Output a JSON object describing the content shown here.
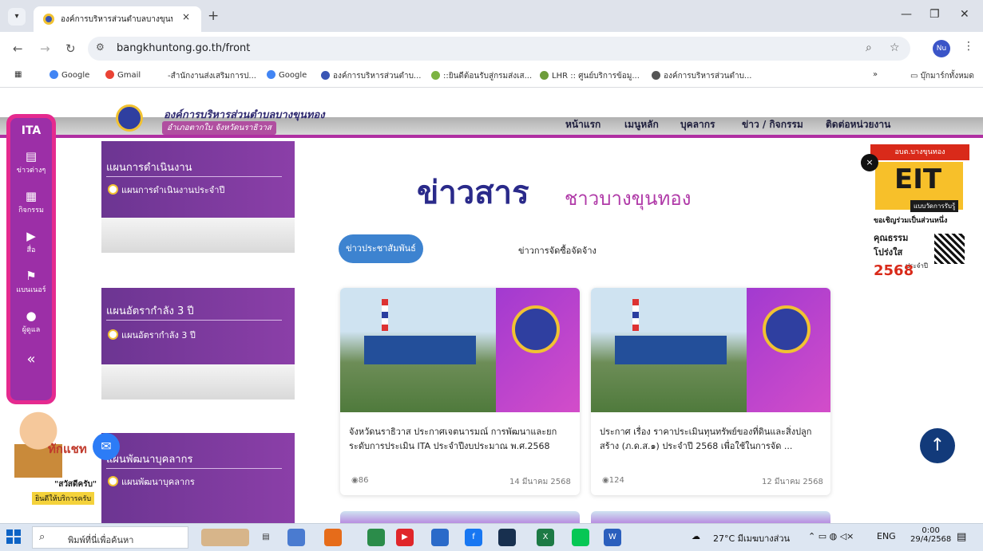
{
  "browser": {
    "tab_title": "องค์การบริหารส่วนตำบลบางขุนทอง",
    "tab_close": "×",
    "new_tab": "+",
    "url": "bangkhuntong.go.th/front",
    "profile": "Nu",
    "bookmarks": [
      {
        "label": "Google",
        "color": "#4285f4"
      },
      {
        "label": "Gmail",
        "color": "#ea4335"
      },
      {
        "label": "-สำนักงานส่งเสริมการป...",
        "color": "#ffffff"
      },
      {
        "label": "Google",
        "color": "#4285f4"
      },
      {
        "label": "องค์การบริหารส่วนตำบ...",
        "color": "#3a55b4"
      },
      {
        "label": "::ยินดีต้อนรับสู่กรมส่งเส...",
        "color": "#7cb342"
      },
      {
        "label": "LHR :: ศูนย์บริการข้อมู...",
        "color": "#6d9c3a"
      },
      {
        "label": "องค์การบริหารส่วนตำบ...",
        "color": "#555555"
      }
    ],
    "bookmarks_more": "»",
    "all_bookmarks": "บุ๊กมาร์กทั้งหมด"
  },
  "site": {
    "org_name": "องค์การบริหารส่วนตำบลบางขุนทอง",
    "org_sub": "อำเภอตากใบ จังหวัดนราธิวาส",
    "nav": [
      "หน้าแรก",
      "เมนูหลัก",
      "บุคลากร",
      "ข่าว / กิจกรรม",
      "ติดต่อหน่วยงาน"
    ]
  },
  "rail": {
    "logo": "ITA",
    "items": [
      {
        "label": "ข่าวต่างๆ",
        "icon": "newspaper-icon"
      },
      {
        "label": "กิจกรรม",
        "icon": "calendar-icon"
      },
      {
        "label": "สื่อ",
        "icon": "play-icon"
      },
      {
        "label": "แบนเนอร์",
        "icon": "flag-icon"
      },
      {
        "label": "ผู้ดูแล",
        "icon": "user-icon"
      }
    ],
    "collapse": "«"
  },
  "menu": {
    "sections": [
      {
        "heading": "แผนการดำเนินงาน",
        "item": "แผนการดำเนินงานประจำปี"
      },
      {
        "heading": "แผนอัตรากำลัง 3 ปี",
        "item": "แผนอัตรากำลัง 3 ปี"
      },
      {
        "heading": "แผนพัฒนาบุคลากร",
        "item": "แผนพัฒนาบุคลากร"
      }
    ]
  },
  "news": {
    "title_main": "ข่าวสาร",
    "title_sub": "ชาวบางขุนทอง",
    "tabs": [
      "ข่าวประชาสัมพันธ์",
      "ข่าวการจัดซื้อจัดจ้าง"
    ],
    "cards": [
      {
        "text": "จังหวัดนราธิวาส ประกาศเจตนารมณ์ การพัฒนาและยกระดับการประเมิน ITA ประจำปีงบประมาณ พ.ศ.2568",
        "views": "86",
        "date": "14 มีนาคม 2568"
      },
      {
        "text": "ประกาศ เรื่อง ราคาประเมินทุนทรัพย์ของที่ดินและสิ่งปลูกสร้าง (ภ.ด.ส.๑) ประจำปี 2568 เพื่อใช้ในการจัด ...",
        "views": "124",
        "date": "12 มีนาคม 2568"
      }
    ]
  },
  "eit": {
    "top": "อบต.บางขุนทอง",
    "big": "EIT",
    "sub": "แบบวัดการรับรู้",
    "invite": "ขอเชิญร่วมเป็นส่วนหนึ่ง",
    "line2": "คุณธรรม",
    "line3": "โปร่งใส",
    "year_label": "ประจำปี",
    "year": "2568",
    "close": "×"
  },
  "chat": {
    "main": "ทักแชท",
    "greet": "\"สวัสดีครับ\"",
    "service": "ยินดีให้บริการครับ"
  },
  "taskbar": {
    "search_placeholder": "พิมพ์ที่นี่เพื่อค้นหา",
    "weather": "27°C มีเมฆบางส่วน",
    "lang": "ENG",
    "time": "0:00",
    "date": "29/4/2568"
  }
}
